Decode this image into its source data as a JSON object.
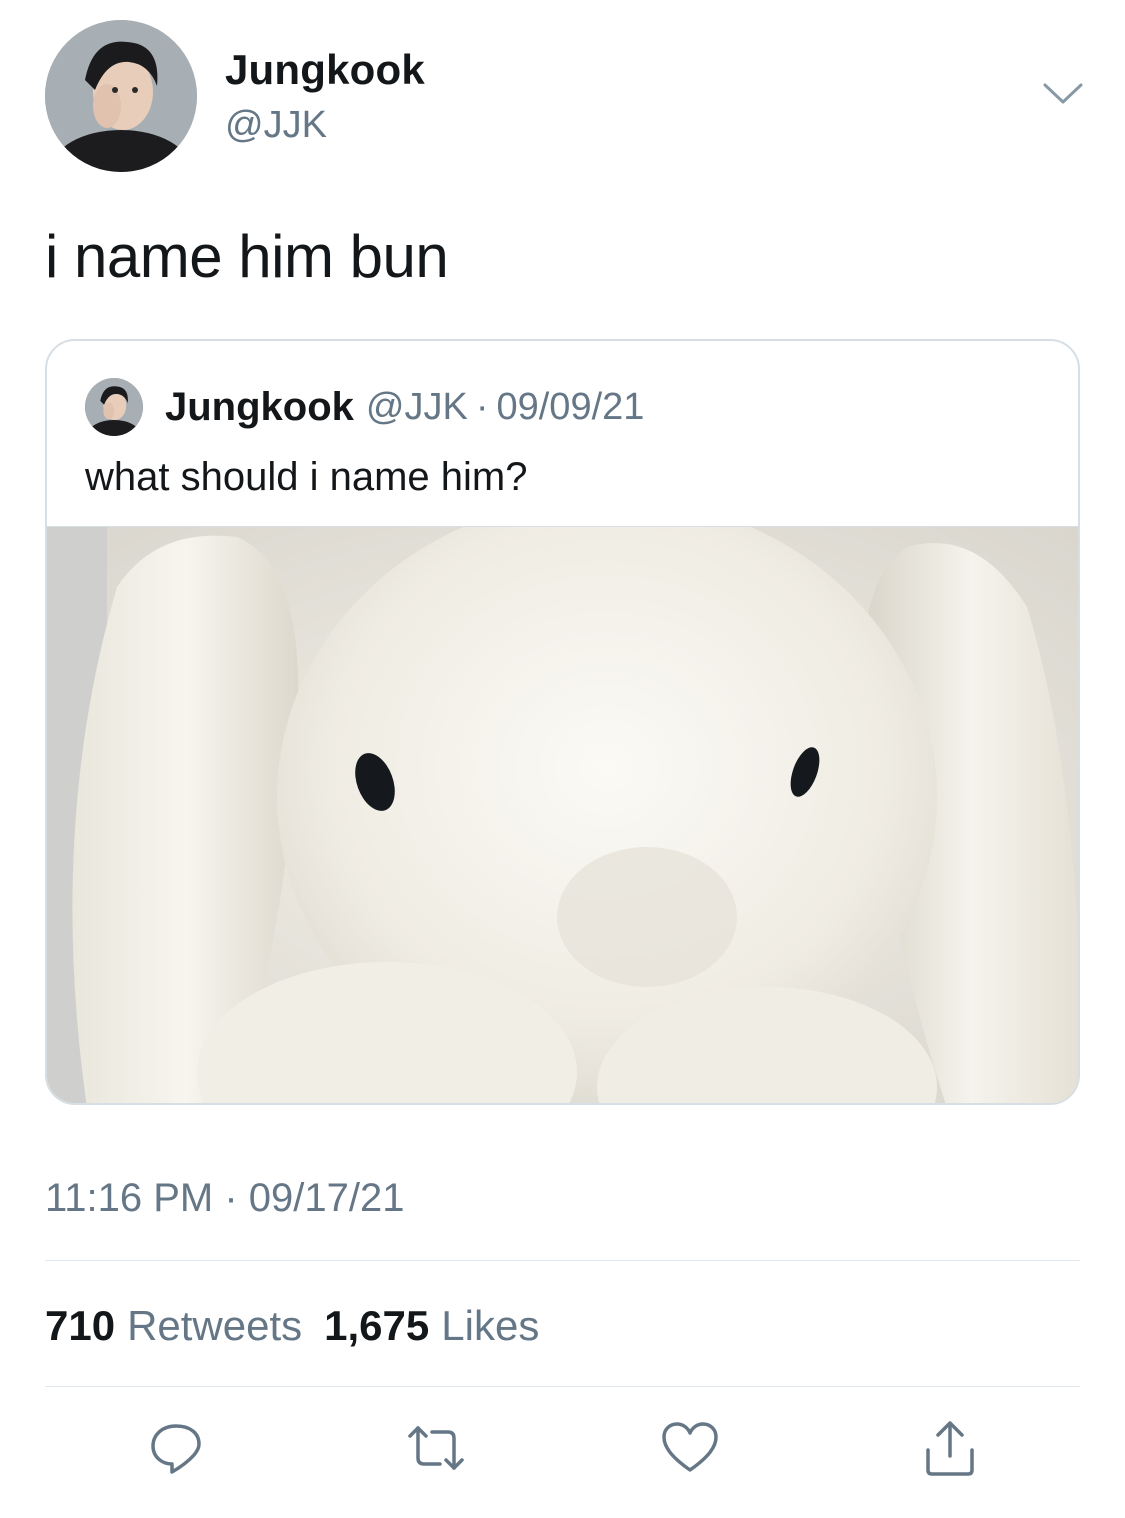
{
  "tweet": {
    "author": {
      "name": "Jungkook",
      "handle": "@JJK"
    },
    "text": "i name him bun",
    "timestamp": "11:16 PM · 09/17/21",
    "stats": {
      "retweets_count": "710",
      "retweets_label": "Retweets",
      "likes_count": "1,675",
      "likes_label": "Likes"
    }
  },
  "quote": {
    "author": {
      "name": "Jungkook",
      "handle": "@JJK"
    },
    "separator": "·",
    "date": "09/09/21",
    "text": "what should i name him?"
  },
  "icons": {
    "menu": "chevron-down-icon",
    "reply": "reply-icon",
    "retweet": "retweet-icon",
    "like": "heart-icon",
    "share": "share-icon"
  },
  "colors": {
    "text": "#14171a",
    "secondary": "#657786",
    "border": "#d8dfe4",
    "icon": "#657786"
  }
}
